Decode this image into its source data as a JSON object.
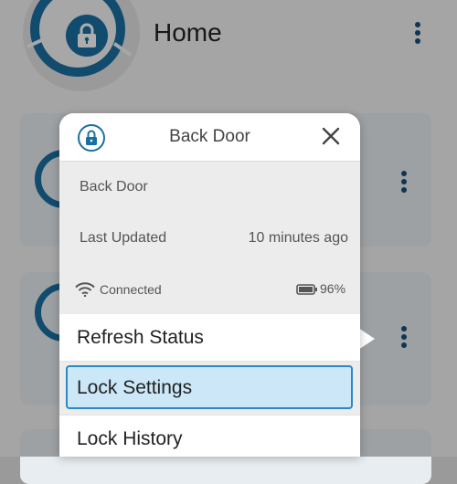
{
  "app": {
    "title": "Home",
    "colors": {
      "accent": "#1a6fa2",
      "highlight": "#cbe7f8",
      "highlight_border": "#2b89c8"
    }
  },
  "popup": {
    "title": "Back Door",
    "lock_name": "Back Door",
    "last_updated_label": "Last Updated",
    "last_updated_value": "10 minutes ago",
    "connection_status": "Connected",
    "battery_level": "96%",
    "menu": [
      {
        "label": "Refresh Status"
      },
      {
        "label": "Lock Settings",
        "selected": true
      },
      {
        "label": "Lock History"
      }
    ]
  },
  "icons": [
    "lock-icon",
    "close-icon",
    "wifi-icon",
    "battery-icon",
    "more-vert-icon"
  ]
}
